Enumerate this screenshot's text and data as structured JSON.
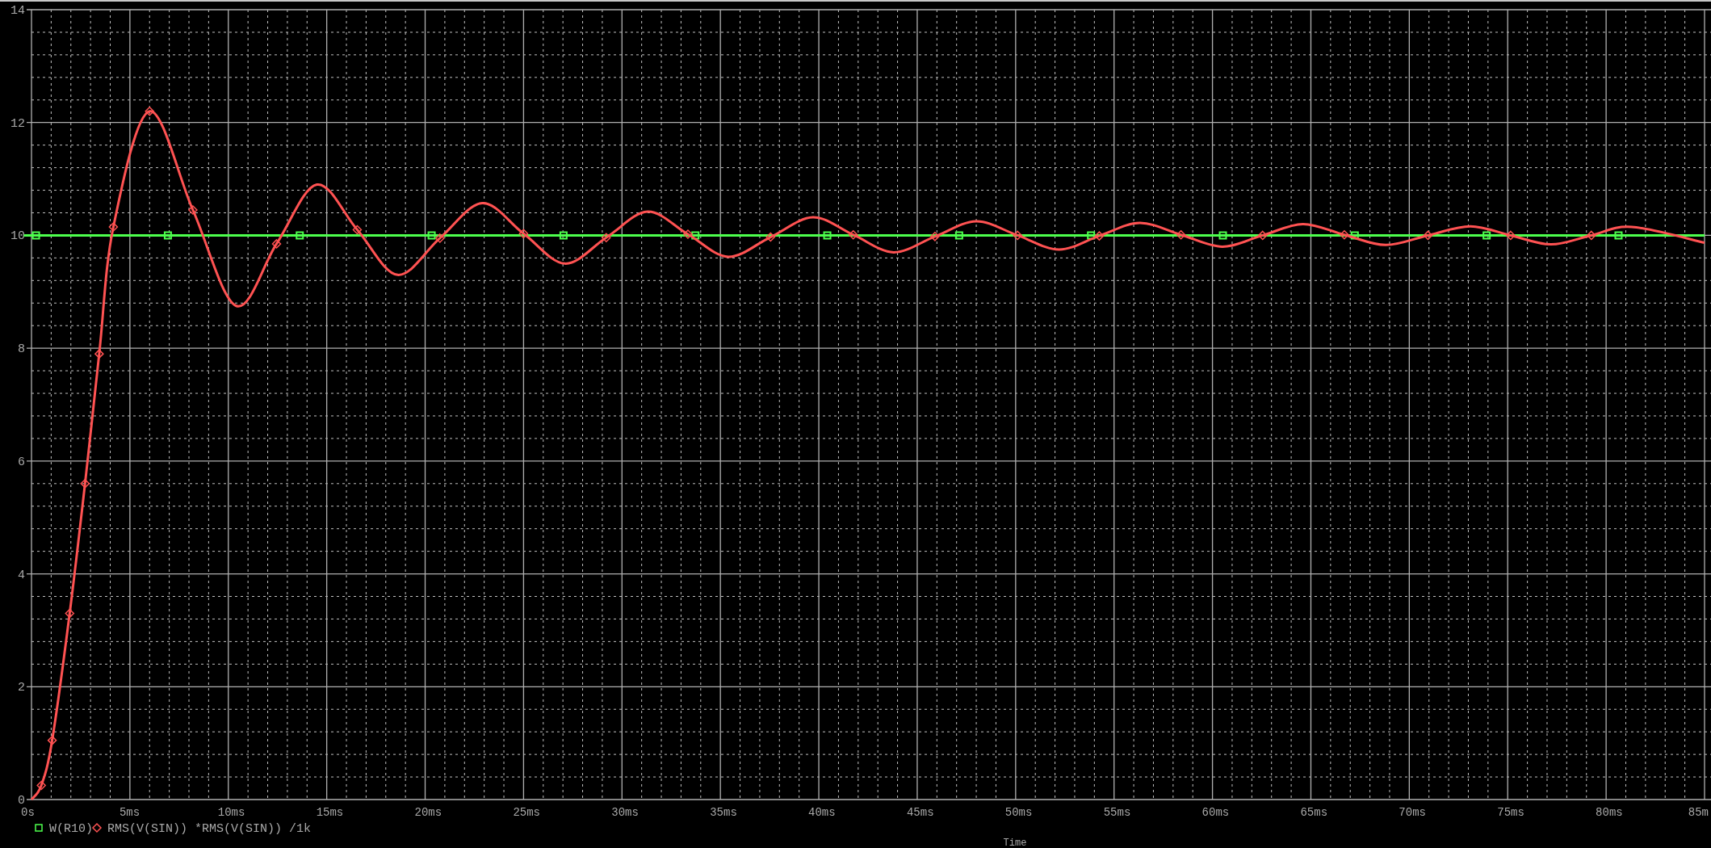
{
  "plot": {
    "chart_data": {
      "type": "line",
      "xlabel": "Time",
      "grid": true,
      "legend": "bottom-left",
      "x": [
        0,
        0.5,
        1.05,
        1.94,
        2.72,
        3.44,
        4.16,
        6.0,
        8.2,
        10.4,
        12.45,
        14.5,
        16.55,
        18.6,
        20.75,
        22.9,
        25.0,
        27.1,
        29.2,
        31.3,
        33.35,
        35.4,
        37.55,
        39.7,
        41.75,
        43.8,
        45.9,
        48,
        50.1,
        52.2,
        54.25,
        56.3,
        58.4,
        60.5,
        62.55,
        64.6,
        66.7,
        68.8,
        70.95,
        73.1,
        75.15,
        77.2,
        79.25,
        81.3,
        85
      ],
      "series": [
        {
          "name": "W(R10)",
          "color": "#4dff4d",
          "marker": "square",
          "x": [
            0,
            0.23,
            6.93,
            13.63,
            20.33,
            27.03,
            33.73,
            40.43,
            47.13,
            53.83,
            60.53,
            67.23,
            73.93,
            80.63,
            85
          ],
          "values": [
            10,
            10,
            10,
            10,
            10,
            10,
            10,
            10,
            10,
            10,
            10,
            10,
            10,
            10,
            10
          ]
        },
        {
          "name": "RMS(V(SIN)) *RMS(V(SIN)) /1k",
          "color": "#ff5252",
          "marker": "diamond",
          "values": [
            0,
            0.25,
            1.05,
            3.3,
            5.6,
            7.9,
            10.15,
            12.2,
            10.45,
            8.75,
            9.85,
            10.9,
            10.1,
            9.3,
            9.95,
            10.57,
            10.03,
            9.5,
            9.96,
            10.42,
            10.02,
            9.62,
            9.97,
            10.32,
            10.01,
            9.7,
            9.98,
            10.25,
            10.0,
            9.75,
            9.99,
            10.22,
            10.01,
            9.8,
            10.0,
            10.2,
            10.01,
            9.83,
            10.0,
            10.16,
            10.0,
            9.84,
            10.0,
            10.15,
            9.87
          ]
        }
      ],
      "xlim": [
        0,
        85
      ],
      "ylim": [
        0,
        14
      ],
      "xticks": [
        {
          "value": 0,
          "label": "0s"
        },
        {
          "value": 5,
          "label": "5ms"
        },
        {
          "value": 10,
          "label": "10ms"
        },
        {
          "value": 15,
          "label": "15ms"
        },
        {
          "value": 20,
          "label": "20ms"
        },
        {
          "value": 25,
          "label": "25ms"
        },
        {
          "value": 30,
          "label": "30ms"
        },
        {
          "value": 35,
          "label": "35ms"
        },
        {
          "value": 40,
          "label": "40ms"
        },
        {
          "value": 45,
          "label": "45ms"
        },
        {
          "value": 50,
          "label": "50ms"
        },
        {
          "value": 55,
          "label": "55ms"
        },
        {
          "value": 60,
          "label": "60ms"
        },
        {
          "value": 65,
          "label": "65ms"
        },
        {
          "value": 70,
          "label": "70ms"
        },
        {
          "value": 75,
          "label": "75ms"
        },
        {
          "value": 80,
          "label": "80ms"
        },
        {
          "value": 85,
          "label": "85m"
        }
      ],
      "yticks": [
        {
          "value": 0,
          "label": "0"
        },
        {
          "value": 2,
          "label": "2"
        },
        {
          "value": 4,
          "label": "4"
        },
        {
          "value": 6,
          "label": "6"
        },
        {
          "value": 8,
          "label": "8"
        },
        {
          "value": 10,
          "label": "10"
        },
        {
          "value": 12,
          "label": "12"
        },
        {
          "value": 14,
          "label": "14"
        }
      ]
    }
  }
}
